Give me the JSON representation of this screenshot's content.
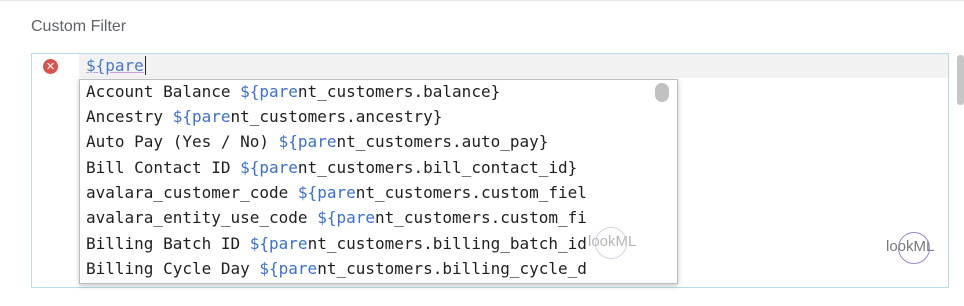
{
  "section": {
    "label": "Custom Filter"
  },
  "editor": {
    "code_text": "${pare",
    "error_icon": "error-icon"
  },
  "autocomplete": {
    "items": [
      {
        "prefix": "Account Balance ",
        "match": "${pare",
        "rest": "nt_customers.balance}"
      },
      {
        "prefix": "Ancestry ",
        "match": "${pare",
        "rest": "nt_customers.ancestry}"
      },
      {
        "prefix": "Auto Pay (Yes / No) ",
        "match": "${pare",
        "rest": "nt_customers.auto_pay}"
      },
      {
        "prefix": "Bill Contact ID ",
        "match": "${pare",
        "rest": "nt_customers.bill_contact_id}"
      },
      {
        "prefix": "avalara_customer_code ",
        "match": "${pare",
        "rest": "nt_customers.custom_fiel"
      },
      {
        "prefix": "avalara_entity_use_code ",
        "match": "${pare",
        "rest": "nt_customers.custom_fi"
      },
      {
        "prefix": "Billing Batch ID ",
        "match": "${pare",
        "rest": "nt_customers.billing_batch_id"
      },
      {
        "prefix": "Billing Cycle Day ",
        "match": "${pare",
        "rest": "nt_customers.billing_cycle_d"
      }
    ]
  },
  "watermark": {
    "text": "lookML"
  },
  "colors": {
    "match": "#3b6fd1",
    "code": "#4a78c4",
    "error": "#d9534f",
    "border": "#b9dcea"
  }
}
